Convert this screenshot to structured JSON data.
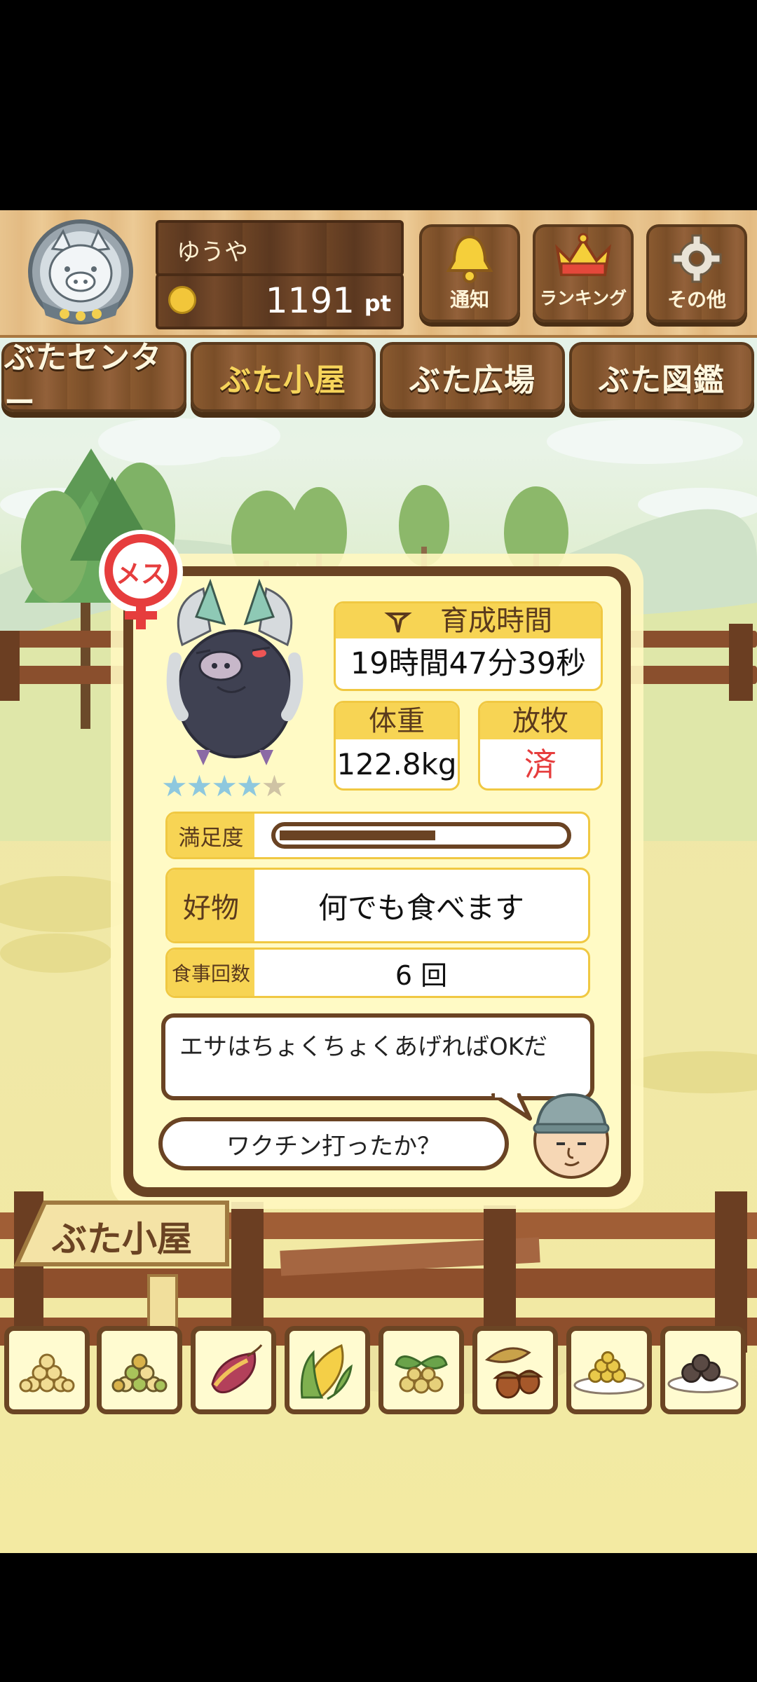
{
  "header": {
    "username": "ゆうや",
    "points_value": "1191",
    "points_unit": "pt",
    "buttons": [
      {
        "label": "通知",
        "icon": "bell-icon"
      },
      {
        "label": "ランキング",
        "icon": "crown-icon"
      },
      {
        "label": "その他",
        "icon": "gear-icon"
      }
    ]
  },
  "tabs": [
    {
      "label": "ぶたセンター",
      "active": false
    },
    {
      "label": "ぶた小屋",
      "active": true
    },
    {
      "label": "ぶた広場",
      "active": false
    },
    {
      "label": "ぶた図鑑",
      "active": false
    }
  ],
  "pig": {
    "gender_label": "メス",
    "stars_filled": 4,
    "stars_total": 5,
    "raising_time_label": "育成時間",
    "raising_time_value": "19時間47分39秒",
    "weight_label": "体重",
    "weight_value": "122.8kg",
    "pasture_label": "放牧",
    "pasture_value": "済",
    "satisfaction_label": "満足度",
    "satisfaction_level": 0.55,
    "favorite_label": "好物",
    "favorite_value": "何でも食べます",
    "meals_label": "食事回数",
    "meals_value": "6 回"
  },
  "dialog": {
    "farmer_message": "エサはちょくちょくあげればOKだ",
    "user_reply": "ワクチン打ったか？"
  },
  "location_sign": "ぶた小屋",
  "feed_items": [
    {
      "icon": "soybeans-icon"
    },
    {
      "icon": "mixed-beans-icon"
    },
    {
      "icon": "sweet-potato-icon"
    },
    {
      "icon": "corn-icon"
    },
    {
      "icon": "vegetable-seeds-icon"
    },
    {
      "icon": "acorn-icon"
    },
    {
      "icon": "feed-plate-icon"
    },
    {
      "icon": "meatball-plate-icon"
    }
  ],
  "colors": {
    "wood_dark": "#6a4323",
    "card_bg": "#fffac5",
    "label_yellow": "#f7d454",
    "accent_red": "#e63d3d",
    "star_blue": "#8ec8de"
  }
}
